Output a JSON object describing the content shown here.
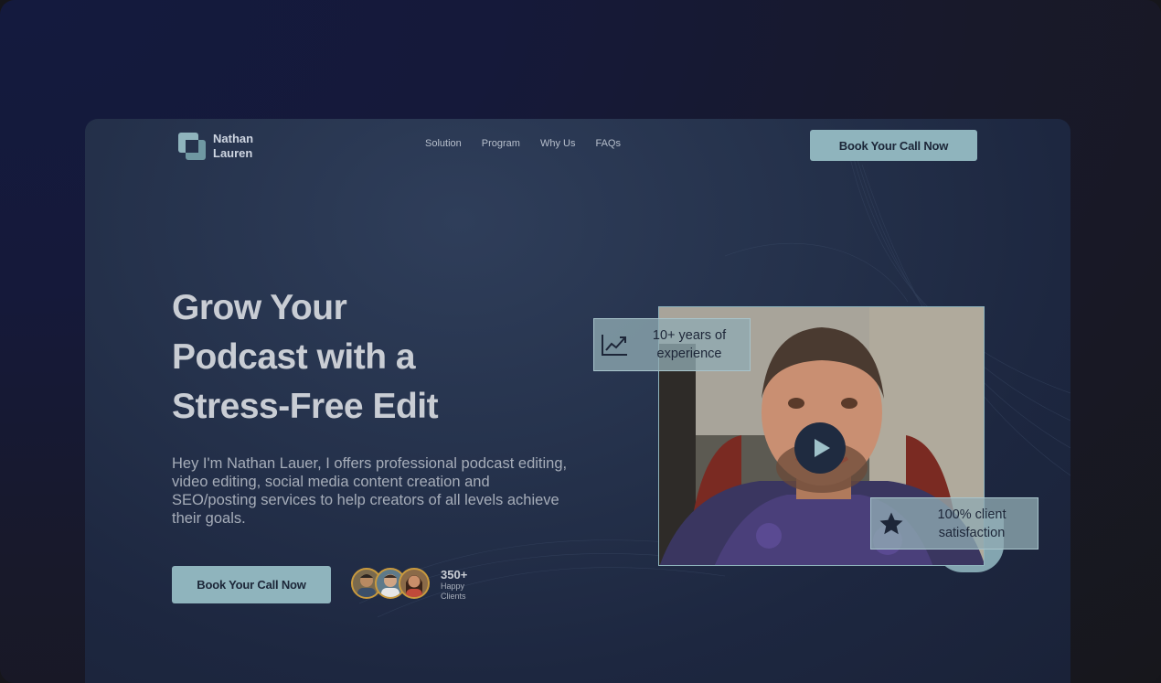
{
  "brand": {
    "name_line1": "Nathan",
    "name_line2": "Lauren"
  },
  "nav": {
    "items": [
      "Solution",
      "Program",
      "Why Us",
      "FAQs"
    ]
  },
  "header": {
    "cta_label": "Book Your Call Now"
  },
  "hero": {
    "headline_line1": "Grow Your",
    "headline_line2": "Podcast with a",
    "headline_line3": "Stress-Free Edit",
    "description": "Hey I'm Nathan Lauer, I offers professional podcast editing, video editing, social media content creation and SEO/posting services to help creators of all levels achieve their goals.",
    "cta_label": "Book Your Call Now",
    "clients_count": "350+",
    "clients_label_line1": "Happy",
    "clients_label_line2": "Clients"
  },
  "badges": {
    "experience_line1": "10+ years of",
    "experience_line2": "experience",
    "satisfaction_line1": "100% client",
    "satisfaction_line2": "satisfaction"
  },
  "icons": {
    "experience": "trend-chart-icon",
    "satisfaction": "star-icon",
    "video": "play-icon"
  },
  "colors": {
    "accent": "#8fb4bd",
    "background": "#1d2740",
    "text": "#c9cdd4"
  }
}
